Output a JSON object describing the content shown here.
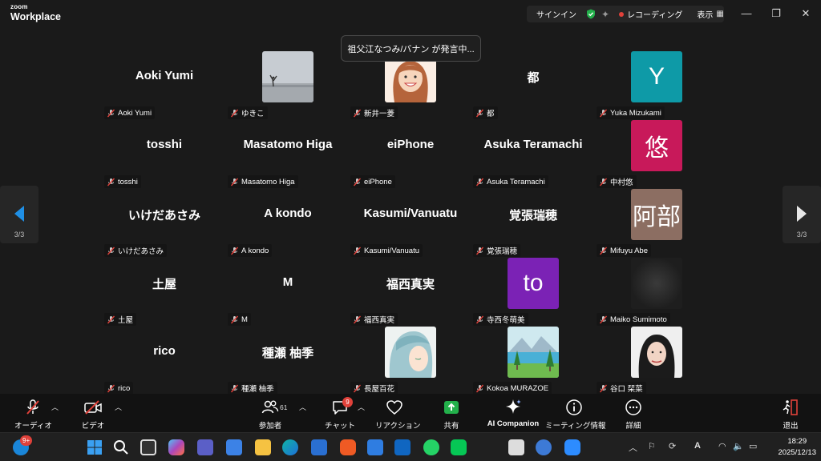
{
  "window": {
    "logo_top": "zoom",
    "logo_bottom": "Workplace",
    "signin": "サインイン",
    "recording": "レコーディング",
    "view": "表示",
    "minimize_glyph": "—",
    "maximize_glyph": "❐",
    "close_glyph": "✕"
  },
  "toast": "祖父江なつみ/バナン が発言中...",
  "page_indicator": "3/3",
  "participants": [
    {
      "display": "Aoki Yumi",
      "label": "Aoki Yumi",
      "type": "text"
    },
    {
      "display": "",
      "label": "ゆきこ",
      "type": "photo",
      "photo": "beach"
    },
    {
      "display": "",
      "label": "新井一菱",
      "type": "photo",
      "photo": "cartoon-woman"
    },
    {
      "display": "都",
      "label": "都",
      "type": "text"
    },
    {
      "display": "Y",
      "label": "Yuka Mizukami",
      "type": "initial",
      "color": "#0e9aa7"
    },
    {
      "display": "tosshi",
      "label": "tosshi",
      "type": "text"
    },
    {
      "display": "Masatomo Higa",
      "label": "Masatomo Higa",
      "type": "text"
    },
    {
      "display": "eiPhone",
      "label": "eiPhone",
      "type": "text"
    },
    {
      "display": "Asuka Teramachi",
      "label": "Asuka Teramachi",
      "type": "text"
    },
    {
      "display": "悠",
      "label": "中村悠",
      "type": "initial",
      "color": "#c8195a"
    },
    {
      "display": "いけだあさみ",
      "label": "いけだあさみ",
      "type": "text"
    },
    {
      "display": "A kondo",
      "label": "A kondo",
      "type": "text"
    },
    {
      "display": "Kasumi/Vanuatu",
      "label": "Kasumi/Vanuatu",
      "type": "text"
    },
    {
      "display": "覚張瑞穂",
      "label": "覚張瑞穂",
      "type": "text"
    },
    {
      "display": "阿部",
      "label": "Mifuyu  Abe",
      "type": "initial",
      "color": "#8c6e62"
    },
    {
      "display": "土屋",
      "label": "土屋",
      "type": "text"
    },
    {
      "display": "M",
      "label": "M",
      "type": "text"
    },
    {
      "display": "福西真実",
      "label": "福西真実",
      "type": "text"
    },
    {
      "display": "to",
      "label": "寺西冬萌美",
      "type": "initial",
      "color": "#7b22b5"
    },
    {
      "display": "",
      "label": "Maiko Sumimoto",
      "type": "photo",
      "photo": "dark-blur"
    },
    {
      "display": "rico",
      "label": "rico",
      "type": "text"
    },
    {
      "display": "種瀬 柚季",
      "label": "種瀬 柚季",
      "type": "text"
    },
    {
      "display": "",
      "label": "長屋百花",
      "type": "photo",
      "photo": "anime-blue-hair"
    },
    {
      "display": "",
      "label": "Kokoa MURAZOE",
      "type": "photo",
      "photo": "landscape"
    },
    {
      "display": "",
      "label": "谷口 栞菜",
      "type": "photo",
      "photo": "woman-portrait"
    }
  ],
  "toolbar": {
    "audio": "オーディオ",
    "video": "ビデオ",
    "participants": "参加者",
    "participants_count": "61",
    "chat": "チャット",
    "chat_badge": "9",
    "reactions": "リアクション",
    "share": "共有",
    "ai": "AI Companion",
    "info": "ミーティング情報",
    "more": "詳細",
    "leave": "退出"
  },
  "taskbar": {
    "notify_badge": "9+",
    "time": "18:29",
    "date": "2025/12/13",
    "ime": "A"
  }
}
